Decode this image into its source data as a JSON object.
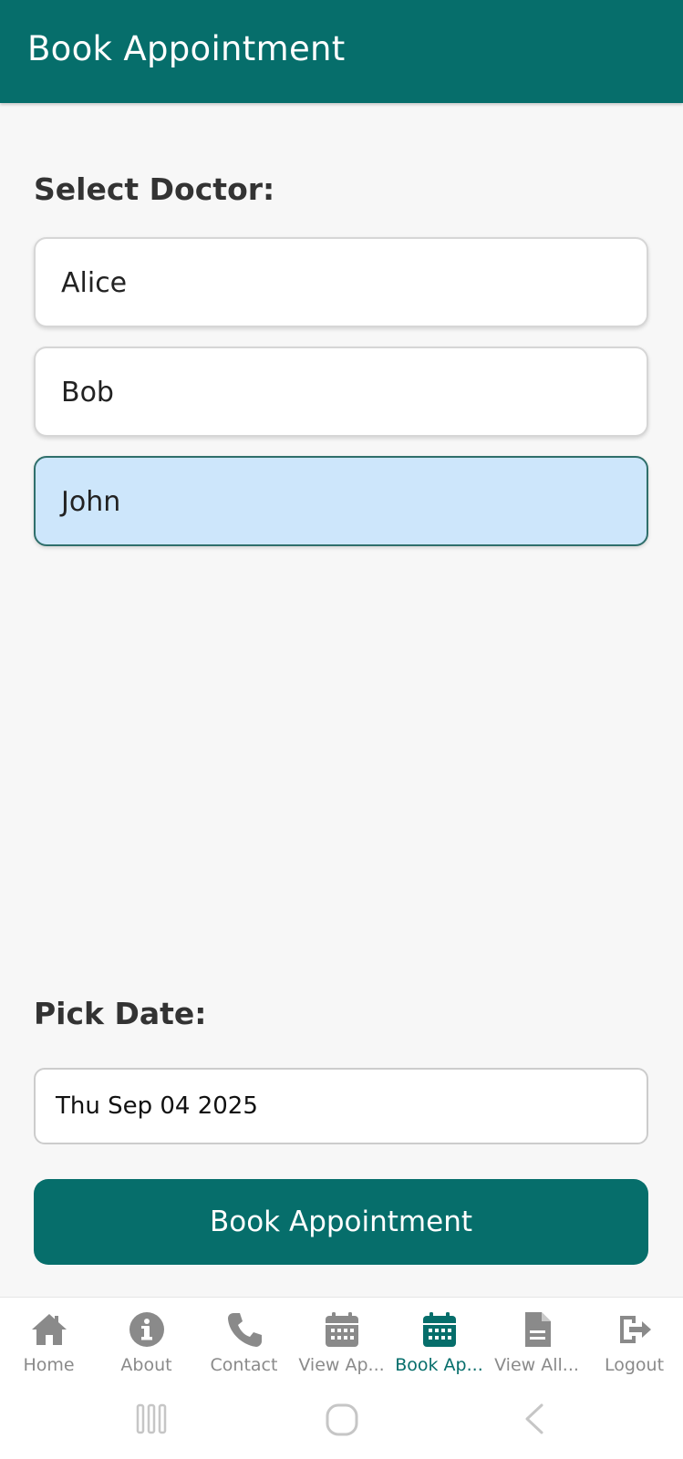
{
  "header": {
    "title": "Book Appointment"
  },
  "doctor_section": {
    "label": "Select Doctor:",
    "options": [
      {
        "name": "Alice",
        "selected": false
      },
      {
        "name": "Bob",
        "selected": false
      },
      {
        "name": "John",
        "selected": true
      }
    ]
  },
  "date_section": {
    "label": "Pick Date:",
    "value": "Thu Sep 04 2025"
  },
  "book_button": {
    "label": "Book Appointment"
  },
  "tabs": [
    {
      "label": "Home",
      "icon": "home-icon"
    },
    {
      "label": "About",
      "icon": "info-icon"
    },
    {
      "label": "Contact",
      "icon": "phone-icon"
    },
    {
      "label": "View Ap...",
      "icon": "calendar-icon"
    },
    {
      "label": "Book Ap...",
      "icon": "calendar-icon",
      "active": true
    },
    {
      "label": "View All...",
      "icon": "document-icon"
    },
    {
      "label": "Logout",
      "icon": "logout-icon"
    }
  ],
  "colors": {
    "primary": "#066e6b",
    "selected_bg": "#cde6fb",
    "inactive": "#8a8a8a"
  },
  "system_nav": [
    "recent-apps-icon",
    "home-button-icon",
    "back-icon"
  ]
}
